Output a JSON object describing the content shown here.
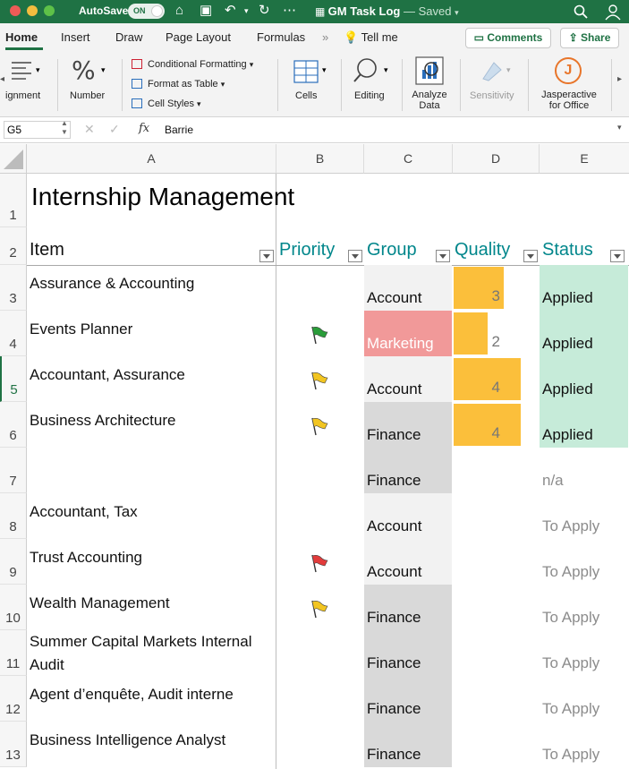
{
  "titlebar": {
    "autosave_label": "AutoSave",
    "autosave_state": "ON",
    "doc_name": "GM Task Log",
    "doc_status": "— Saved"
  },
  "tabs": [
    "Home",
    "Insert",
    "Draw",
    "Page Layout",
    "Formulas"
  ],
  "tell_me": "Tell me",
  "comments_label": "Comments",
  "share_label": "Share",
  "ribbon": {
    "alignment": "ignment",
    "number": "Number",
    "conditional_formatting": "Conditional Formatting",
    "format_as_table": "Format as Table",
    "cell_styles": "Cell Styles",
    "cells": "Cells",
    "editing": "Editing",
    "analyze_data": "Analyze Data",
    "sensitivity": "Sensitivity",
    "jasperactive": "Jasperactive for Office",
    "jasperactive_logo": "J"
  },
  "formula_bar": {
    "name_box": "G5",
    "fx": "fx",
    "value": "Barrie"
  },
  "columns": [
    "A",
    "B",
    "C",
    "D",
    "E"
  ],
  "sheet": {
    "title": "Internship Management",
    "headers": {
      "item": "Item",
      "priority": "Priority",
      "group": "Group",
      "quality": "Quality",
      "status": "Status"
    },
    "rows": [
      {
        "num": "1"
      },
      {
        "num": "2"
      },
      {
        "num": "3",
        "item": "Assurance & Accounting",
        "priority": "",
        "group": "Account",
        "quality": "3",
        "status": "Applied"
      },
      {
        "num": "4",
        "item": "Events Planner",
        "priority": "green",
        "group": "Marketing",
        "quality": "2",
        "status": "Applied"
      },
      {
        "num": "5",
        "item": "Accountant, Assurance",
        "priority": "yellow",
        "group": "Account",
        "quality": "4",
        "status": "Applied"
      },
      {
        "num": "6",
        "item": "Business Architecture",
        "priority": "yellow",
        "group": "Finance",
        "quality": "4",
        "status": "Applied"
      },
      {
        "num": "7",
        "item": "",
        "priority": "",
        "group": "Finance",
        "quality": "",
        "status": "n/a"
      },
      {
        "num": "8",
        "item": "Accountant, Tax",
        "priority": "",
        "group": "Account",
        "quality": "",
        "status": "To Apply"
      },
      {
        "num": "9",
        "item": "Trust Accounting",
        "priority": "red",
        "group": "Account",
        "quality": "",
        "status": "To Apply"
      },
      {
        "num": "10",
        "item": "Wealth Management",
        "priority": "yellow",
        "group": "Finance",
        "quality": "",
        "status": "To Apply"
      },
      {
        "num": "11",
        "item": "Summer Capital Markets Internal Audit",
        "priority": "",
        "group": "Finance",
        "quality": "",
        "status": "To Apply"
      },
      {
        "num": "12",
        "item": "Agent d’enquête, Audit interne",
        "priority": "",
        "group": "Finance",
        "quality": "",
        "status": "To Apply"
      },
      {
        "num": "13",
        "item": "Business Intelligence Analyst",
        "priority": "",
        "group": "Finance",
        "quality": "",
        "status": "To Apply"
      }
    ]
  },
  "colors": {
    "excel_green": "#1f7244",
    "header_teal": "#00868b",
    "account_fill": "#f2f2f2",
    "finance_fill": "#d9d9d9",
    "marketing_fill": "#f19999",
    "quality_bar": "#fbbf3b",
    "applied_fill": "#c6ebd9",
    "muted_status": "#8c8c8c",
    "flag_green": "#2a9d3a",
    "flag_yellow": "#f2c521",
    "flag_red": "#e23b3b"
  }
}
